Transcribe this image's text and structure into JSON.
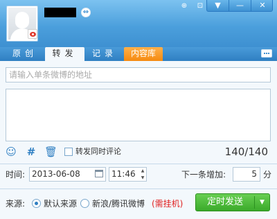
{
  "header": {
    "switch_icon": "⇔",
    "pin_icon": "⊕",
    "float_icon": "⊡",
    "dropdown_icon": "▼",
    "minimize_icon": "—",
    "close_icon": "✕"
  },
  "tabs": [
    {
      "label": "原创"
    },
    {
      "label": "转发"
    },
    {
      "label": "记录"
    },
    {
      "label": "内容库"
    }
  ],
  "compose": {
    "url_placeholder": "请输入单条微博的地址",
    "url_value": "",
    "comment_value": "",
    "also_comment_label": "转发同时评论",
    "also_comment_checked": false,
    "counter": "140/140"
  },
  "toolbar_icons": {
    "emoji": "☺",
    "topic": "#",
    "trash": "🗑"
  },
  "schedule": {
    "time_label": "时间:",
    "date": "2013-06-08",
    "time": "11:46",
    "next_label": "下一条增加:",
    "interval": "5",
    "unit": "分"
  },
  "source": {
    "label": "来源:",
    "options": [
      {
        "label": "默认来源",
        "selected": true
      },
      {
        "label": "新浪/腾讯微博",
        "selected": false
      }
    ],
    "note": "(需挂机)"
  },
  "send": {
    "label": "定时发送",
    "arrow": "▼"
  },
  "colors": {
    "header": "#4b9fdc",
    "tab_highlight": "#f58a10",
    "send_button": "#3aaa2a",
    "note": "#e02020"
  }
}
